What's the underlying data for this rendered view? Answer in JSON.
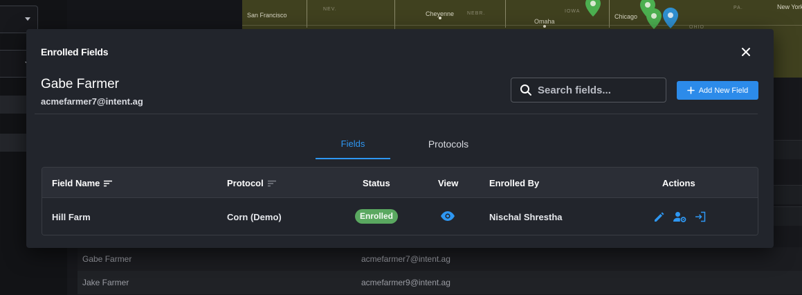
{
  "background": {
    "map_labels": [
      "San Francisco",
      "NEV.",
      "Cheyenne",
      "NEBR.",
      "Omaha",
      "IOWA",
      "Chicago",
      "OHIO",
      "PA.",
      "New York"
    ],
    "table_rows": [
      {
        "name": "Gabe Farmer",
        "email": "acmefarmer7@intent.ag"
      },
      {
        "name": "Jake Farmer",
        "email": "acmefarmer9@intent.ag"
      }
    ]
  },
  "modal": {
    "title": "Enrolled Fields",
    "close_icon": "close-icon",
    "user": {
      "name": "Gabe Farmer",
      "email": "acmefarmer7@intent.ag"
    },
    "search": {
      "placeholder": "Search fields...",
      "value": "",
      "icon": "search-icon"
    },
    "add_button": {
      "label": "Add New Field",
      "icon": "plus-icon"
    },
    "tabs": [
      {
        "label": "Fields",
        "active": true
      },
      {
        "label": "Protocols",
        "active": false
      }
    ],
    "table": {
      "columns": [
        "Field Name",
        "Protocol",
        "Status",
        "View",
        "Enrolled By",
        "Actions"
      ],
      "rows": [
        {
          "field_name": "Hill Farm",
          "protocol": "Corn (Demo)",
          "status": "Enrolled",
          "view_icon": "eye-icon",
          "enrolled_by": "Nischal Shrestha",
          "actions": [
            "edit-icon",
            "manage-user-icon",
            "login-icon"
          ]
        }
      ]
    }
  },
  "colors": {
    "accent": "#2c8bea",
    "status_enrolled": "#5aa860",
    "modal_bg": "#22252c"
  }
}
